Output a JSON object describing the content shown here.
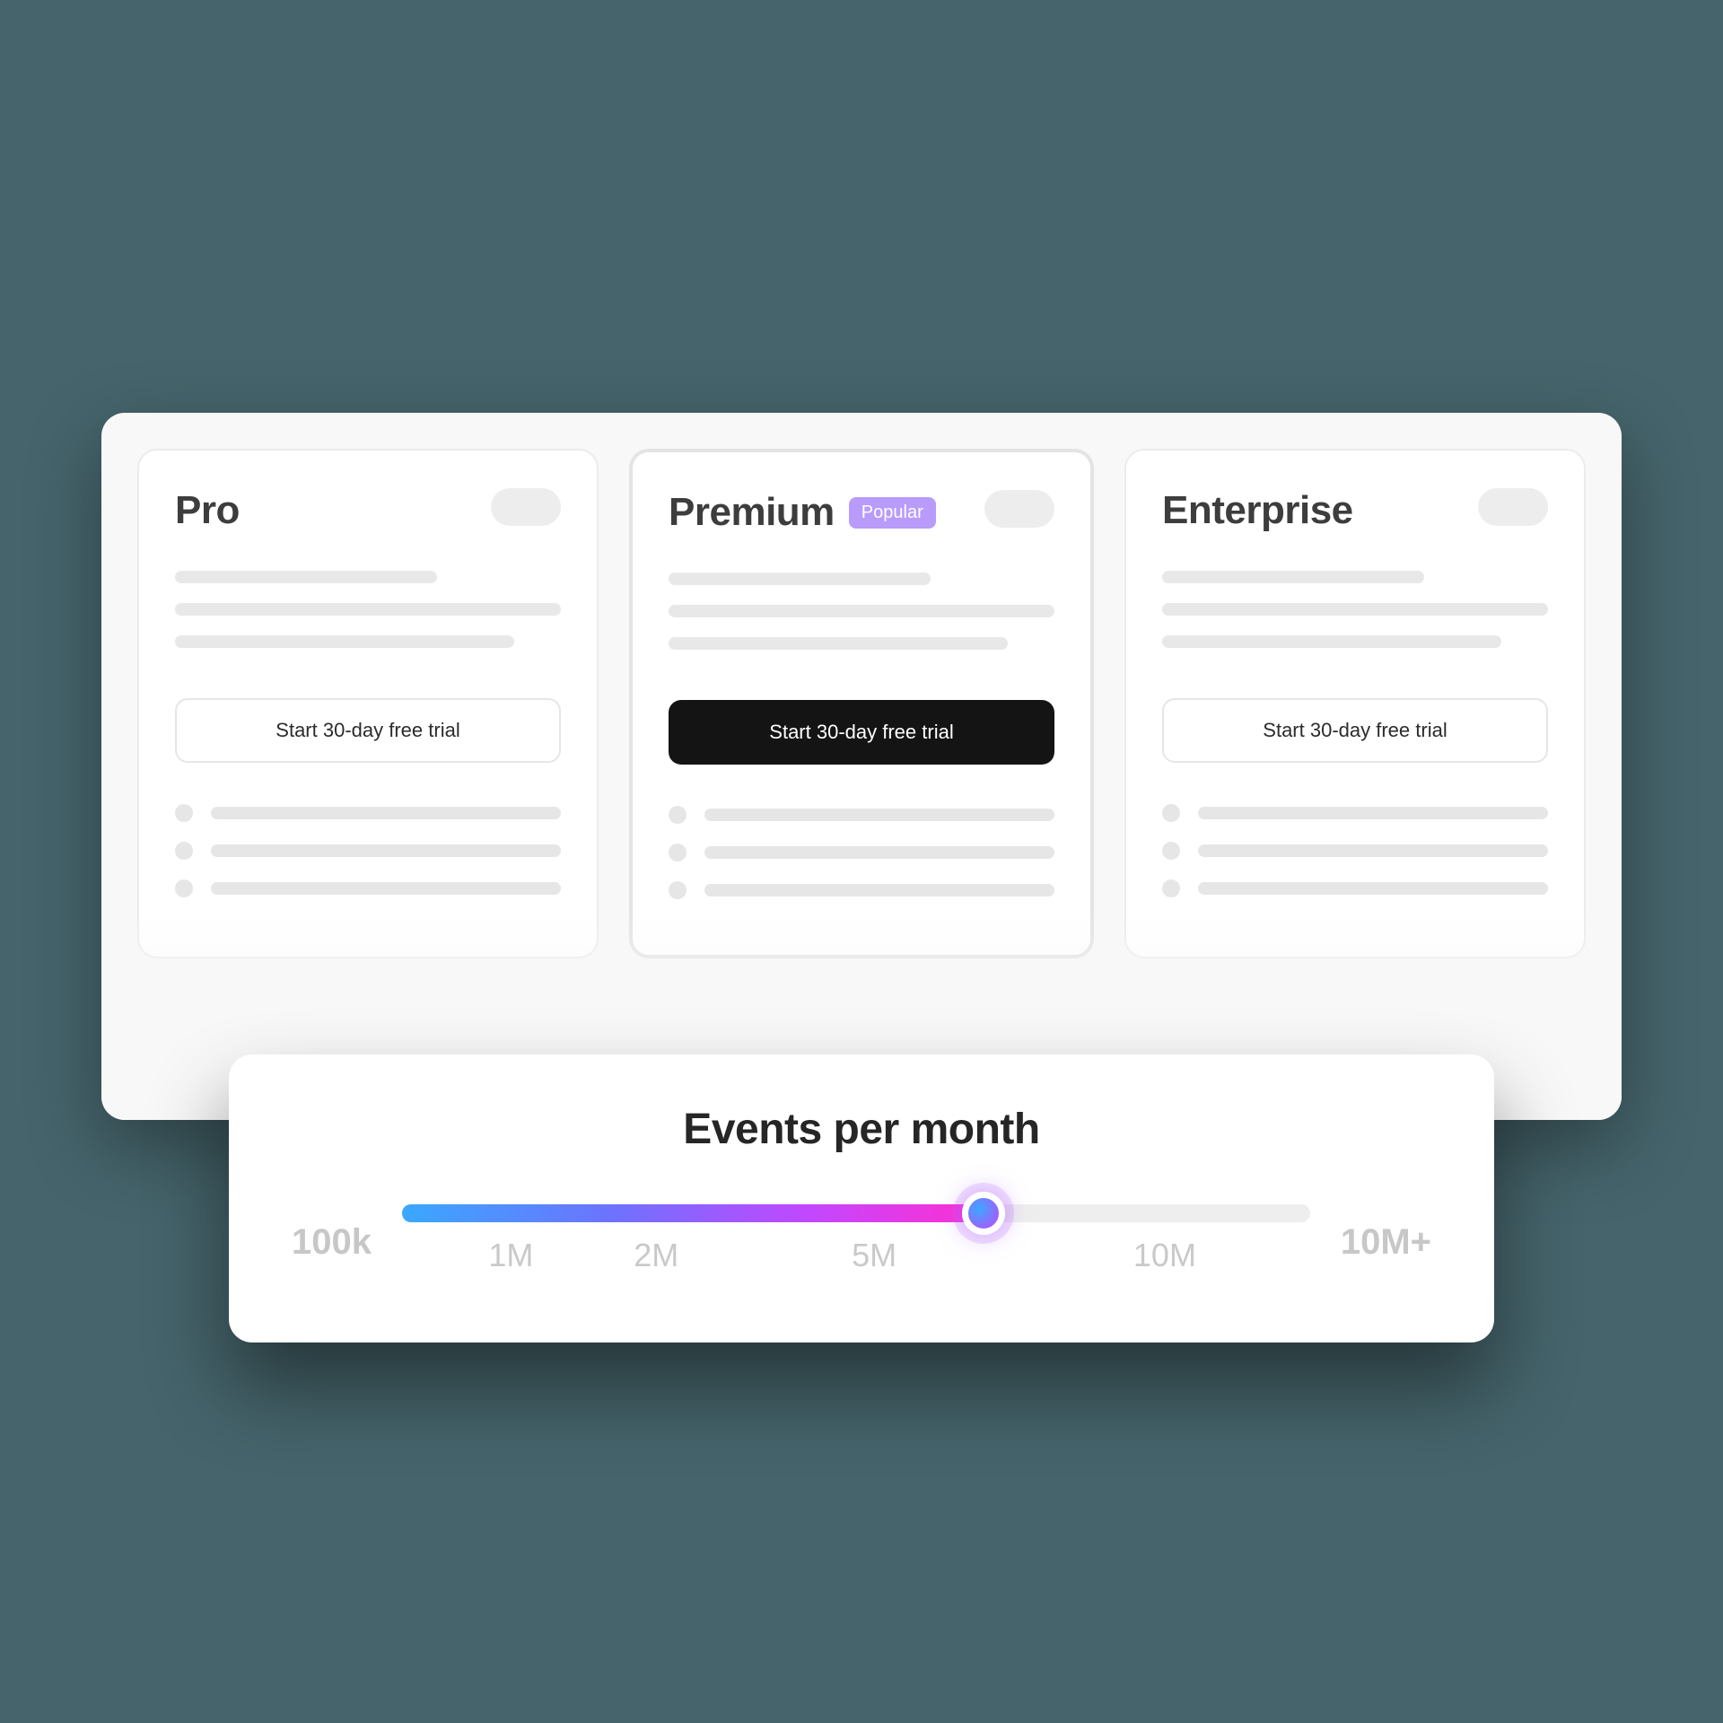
{
  "plans": [
    {
      "name": "Pro",
      "badge": null,
      "cta": "Start 30-day free trial",
      "primary": false
    },
    {
      "name": "Premium",
      "badge": "Popular",
      "cta": "Start 30-day free trial",
      "primary": true
    },
    {
      "name": "Enterprise",
      "badge": null,
      "cta": "Start 30-day free trial",
      "primary": false
    }
  ],
  "slider": {
    "title": "Events per month",
    "min_label": "100k",
    "max_label": "10M+",
    "ticks": [
      {
        "label": "1M",
        "pos": 12
      },
      {
        "label": "2M",
        "pos": 28
      },
      {
        "label": "5M",
        "pos": 52
      },
      {
        "label": "10M",
        "pos": 84
      }
    ],
    "value_pos": 64
  }
}
